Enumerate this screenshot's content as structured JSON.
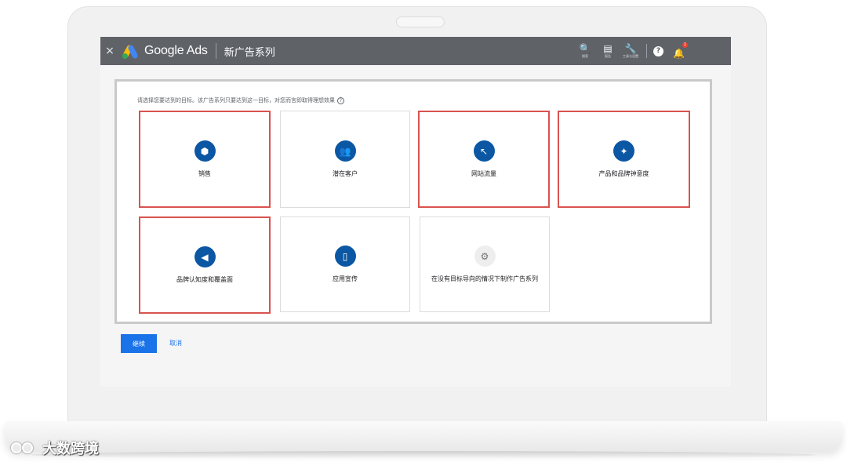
{
  "app": {
    "brand": "Google Ads",
    "title": "新广告系列",
    "close_glyph": "×"
  },
  "toolbar": {
    "tools": [
      {
        "icon": "search-icon",
        "glyph": "🔍",
        "caption": "搜索"
      },
      {
        "icon": "reports-icon",
        "glyph": "▤",
        "caption": "报告"
      },
      {
        "icon": "wrench-icon",
        "glyph": "🔧",
        "caption": "工具与设置"
      }
    ],
    "help_glyph": "?",
    "notification_count": "1"
  },
  "main": {
    "prompt": "请选择您要达到的目标。该广告系列只要达到这一目标，对您而言即取得理想效果",
    "help_glyph": "?",
    "goals": [
      {
        "label": "销售",
        "icon": "tag-icon",
        "glyph": "⬢",
        "selected": true
      },
      {
        "label": "潜在客户",
        "icon": "people-icon",
        "glyph": "👥",
        "selected": false
      },
      {
        "label": "网站流量",
        "icon": "cursor-click-icon",
        "glyph": "↖",
        "selected": true
      },
      {
        "label": "产品和品牌钟意度",
        "icon": "sparkle-icon",
        "glyph": "✦",
        "selected": true
      },
      {
        "label": "品牌认知度和覆盖面",
        "icon": "megaphone-icon",
        "glyph": "◀",
        "selected": true
      },
      {
        "label": "应用宣传",
        "icon": "phone-icon",
        "glyph": "▯",
        "selected": false
      },
      {
        "label": "在没有目标导向的情况下制作广告系列",
        "icon": "gear-icon",
        "glyph": "⚙",
        "selected": false
      }
    ]
  },
  "actions": {
    "continue_label": "继续",
    "cancel_label": "取消"
  },
  "watermark": {
    "text": "大数跨境"
  },
  "colors": {
    "topbar": "#5f6368",
    "accent": "#1a73e8",
    "icon_circle": "#0b57a4",
    "selected_border": "#d9534f"
  }
}
